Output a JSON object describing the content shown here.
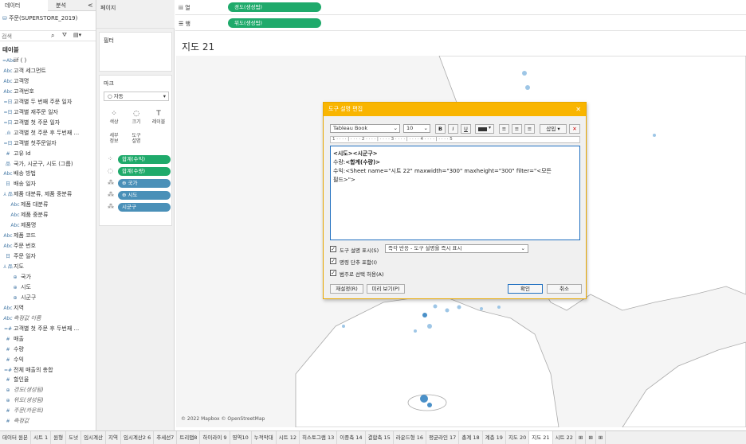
{
  "data_pane": {
    "tab_data": "데이터",
    "tab_analysis": "분석",
    "collapse": "<",
    "datasource": "주문(SUPERSTORE_2019)",
    "search_placeholder": "검색",
    "section_title": "테이블",
    "fields": [
      {
        "icon": "=Abc",
        "label": "iif ( )",
        "italic": false
      },
      {
        "icon": "Abc",
        "label": "고객 세그먼트",
        "italic": false
      },
      {
        "icon": "Abc",
        "label": "고객명",
        "italic": false
      },
      {
        "icon": "Abc",
        "label": "고객번호",
        "italic": false
      },
      {
        "icon": "=日",
        "label": "고객별 두 번째 주문 일자",
        "italic": false
      },
      {
        "icon": "=日",
        "label": "고객별 재주문 일자",
        "italic": false
      },
      {
        "icon": "=日",
        "label": "고객별 첫 주문 일자",
        "italic": false
      },
      {
        "icon": ".ılı",
        "label": "고객별 첫 주문 후 두번째 ...",
        "italic": false
      },
      {
        "icon": "=日",
        "label": "고객별 첫주문일자",
        "italic": false
      },
      {
        "icon": "#",
        "label": "고유 Id",
        "italic": false
      },
      {
        "icon": "品",
        "label": "국가, 시군구, 시도 (그룹)",
        "italic": false
      },
      {
        "icon": "Abc",
        "label": "배송 방법",
        "italic": false
      },
      {
        "icon": "日",
        "label": "배송 일자",
        "italic": false
      },
      {
        "icon": "⅄ 品",
        "label": "제품 대분류, 제품 중분류",
        "italic": false
      },
      {
        "icon": "Abc",
        "label": "제품 대분류",
        "italic": false,
        "indent": true
      },
      {
        "icon": "Abc",
        "label": "제품 중분류",
        "italic": false,
        "indent": true
      },
      {
        "icon": "Abc",
        "label": "제품명",
        "italic": false,
        "indent": true
      },
      {
        "icon": "Abc",
        "label": "제품 코드",
        "italic": false
      },
      {
        "icon": "Abc",
        "label": "주문 번호",
        "italic": false
      },
      {
        "icon": "日",
        "label": "주문 일자",
        "italic": false
      },
      {
        "icon": "⅄ 品",
        "label": "지도",
        "italic": false
      },
      {
        "icon": "⊕",
        "label": "국가",
        "italic": false,
        "indent": true
      },
      {
        "icon": "⊕",
        "label": "시도",
        "italic": false,
        "indent": true
      },
      {
        "icon": "⊕",
        "label": "시군구",
        "italic": false,
        "indent": true
      },
      {
        "icon": "Abc",
        "label": "지역",
        "italic": false
      },
      {
        "icon": "Abc",
        "label": "측정값 이름",
        "italic": true
      },
      {
        "icon": "=#",
        "label": "고객별 첫 주문 후 두번째 ...",
        "italic": false
      },
      {
        "icon": "#",
        "label": "매출",
        "italic": false
      },
      {
        "icon": "#",
        "label": "수량",
        "italic": false
      },
      {
        "icon": "#",
        "label": "수익",
        "italic": false
      },
      {
        "icon": "=#",
        "label": "전체 매출의 총합",
        "italic": false
      },
      {
        "icon": "#",
        "label": "할인율",
        "italic": false
      },
      {
        "icon": "⊕",
        "label": "경도(생성됨)",
        "italic": true
      },
      {
        "icon": "⊕",
        "label": "위도(생성됨)",
        "italic": true
      },
      {
        "icon": "#",
        "label": "주문(카운트)",
        "italic": true
      },
      {
        "icon": "#",
        "label": "측정값",
        "italic": true
      }
    ]
  },
  "cards": {
    "pages": "페이지",
    "filters": "필터",
    "marks": "마크",
    "mark_type": "자동",
    "mark_buttons": [
      {
        "glyph": "⁘",
        "label": "색상"
      },
      {
        "glyph": "◌",
        "label": "크기"
      },
      {
        "glyph": "T",
        "label": "레이블"
      },
      {
        "glyph": "",
        "label": "세부\n정보"
      },
      {
        "glyph": "",
        "label": "도구\n설명"
      }
    ],
    "mark_pills": [
      {
        "icon": "⁘",
        "label": "합계(수익)",
        "color": "g"
      },
      {
        "icon": "◌",
        "label": "합계(수량)",
        "color": "g"
      },
      {
        "icon": "⁂",
        "label": "⊕ 국가",
        "color": "b"
      },
      {
        "icon": "⁂",
        "label": "⊕ 시도",
        "color": "b"
      },
      {
        "icon": "⁂",
        "label": "시군구",
        "color": "b"
      }
    ]
  },
  "shelves": {
    "columns_label": "열",
    "columns_pill": "경도(생성됨)",
    "rows_label": "행",
    "rows_pill": "위도(생성됨)"
  },
  "sheet_title": "지도 21",
  "map_attribution": "© 2022 Mapbox © OpenStreetMap",
  "dialog": {
    "title": "도구 설명 편집",
    "close": "✕",
    "font": "Tableau Book",
    "font_size": "10",
    "bold": "B",
    "italic": "I",
    "underline": "U",
    "insert": "삽입",
    "ruler": "1 · · · · | · · · · 2 · · · · | · · · · 3 · · · · | · · · · 4 · · · · | · · · · 5",
    "text_line1": "<시도><시군구>",
    "text_line2_a": "수량:",
    "text_line2_b": "<합계(수량)>",
    "text_line3_a": "수익:",
    "text_line3_b": "<Sheet name=\"시트 22\" maxwidth=\"300\" maxheight=\"300\" filter=\"<모든",
    "text_line4": "필드>\">",
    "opt1_label": "도구 설명 표시(S)",
    "opt1_select": "즉각 반응 - 도구 설명을 즉시 표시",
    "opt2_label": "명령 단추 포함(I)",
    "opt3_label": "범주로 선택 허용(A)",
    "reset": "재설정(R)",
    "preview": "미리 보기(P)",
    "ok": "확인",
    "cancel": "취소"
  },
  "tabs": [
    "데이터 원본",
    "시트 1",
    "원형",
    "도넛",
    "임시계산",
    "지역",
    "임시계산2 6",
    "추세선7",
    "트리맵8",
    "하이라이 9",
    "영역10",
    "누적막대",
    "시트 12",
    "히스토그램 13",
    "이중축 14",
    "결합축 15",
    "라운드형 16",
    "평균라인 17",
    "총계 18",
    "계층 19",
    "지도 20",
    "지도 21",
    "시트 22"
  ],
  "active_tab": "지도 21"
}
